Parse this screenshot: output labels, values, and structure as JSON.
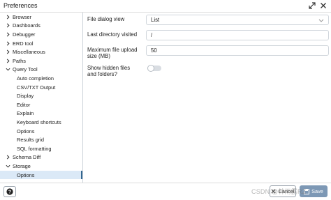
{
  "window": {
    "title": "Preferences"
  },
  "tree": [
    {
      "label": "Browser",
      "expander": "right"
    },
    {
      "label": "Dashboards",
      "expander": "right"
    },
    {
      "label": "Debugger",
      "expander": "right"
    },
    {
      "label": "ERD tool",
      "expander": "right"
    },
    {
      "label": "Miscellaneous",
      "expander": "right"
    },
    {
      "label": "Paths",
      "expander": "right"
    },
    {
      "label": "Query Tool",
      "expander": "down"
    },
    {
      "label": "Auto completion",
      "expander": ""
    },
    {
      "label": "CSV/TXT Output",
      "expander": ""
    },
    {
      "label": "Display",
      "expander": ""
    },
    {
      "label": "Editor",
      "expander": ""
    },
    {
      "label": "Explain",
      "expander": ""
    },
    {
      "label": "Keyboard shortcuts",
      "expander": ""
    },
    {
      "label": "Options",
      "expander": ""
    },
    {
      "label": "Results grid",
      "expander": ""
    },
    {
      "label": "SQL formatting",
      "expander": ""
    },
    {
      "label": "Schema Diff",
      "expander": "right"
    },
    {
      "label": "Storage",
      "expander": "down"
    },
    {
      "label": "Options",
      "expander": "",
      "selected": true
    }
  ],
  "form": {
    "file_dialog_view": {
      "label": "File dialog view",
      "value": "List"
    },
    "last_directory": {
      "label": "Last directory visited",
      "value": "/"
    },
    "max_upload": {
      "label_line1": "Maximum file upload",
      "label_line2": "size (MB)",
      "value": "50"
    },
    "show_hidden": {
      "label_line1": "Show hidden files",
      "label_line2": "and folders?",
      "checked": false
    }
  },
  "footer": {
    "cancel_label": "Cancel",
    "save_label": "Save",
    "watermark": "CSDN @林雨露RZ"
  },
  "colors": {
    "accent": "#326690",
    "selected_bg": "#dbe9f7",
    "save_bg": "#7d98b5"
  }
}
